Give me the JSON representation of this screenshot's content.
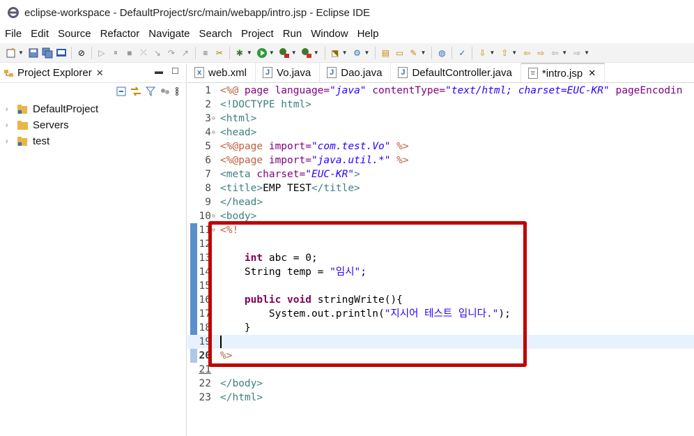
{
  "window": {
    "title": "eclipse-workspace - DefaultProject/src/main/webapp/intro.jsp - Eclipse IDE"
  },
  "menu": [
    "File",
    "Edit",
    "Source",
    "Refactor",
    "Navigate",
    "Search",
    "Project",
    "Run",
    "Window",
    "Help"
  ],
  "explorer": {
    "tab_label": "Project Explorer",
    "items": [
      {
        "label": "DefaultProject",
        "icon": "project-icon"
      },
      {
        "label": "Servers",
        "icon": "folder-icon"
      },
      {
        "label": "test",
        "icon": "project-icon"
      }
    ]
  },
  "editor": {
    "tabs": [
      {
        "label": "web.xml",
        "icon": "xml-file-icon",
        "active": false
      },
      {
        "label": "Vo.java",
        "icon": "java-file-icon",
        "active": false
      },
      {
        "label": "Dao.java",
        "icon": "java-file-icon",
        "active": false
      },
      {
        "label": "DefaultController.java",
        "icon": "java-file-icon",
        "active": false
      },
      {
        "label": "*intro.jsp",
        "icon": "jsp-file-icon",
        "active": true
      }
    ],
    "line_numbers": [
      "1",
      "2",
      "3",
      "4",
      "5",
      "6",
      "7",
      "8",
      "9",
      "10",
      "11",
      "12",
      "13",
      "14",
      "15",
      "16",
      "17",
      "18",
      "19",
      "20",
      "21",
      "22",
      "23"
    ],
    "code": {
      "l1_a": "<%@ ",
      "l1_b": "page ",
      "l1_c": "language=",
      "l1_d": "\"java\"",
      "l1_e": " contentType=",
      "l1_f": "\"text/html; charset=EUC-KR\"",
      "l1_g": " pageEncodin",
      "l2": "<!DOCTYPE html>",
      "l3": "<html>",
      "l4": "<head>",
      "l5_a": "<%@page ",
      "l5_b": "import=",
      "l5_c": "\"com.test.Vo\"",
      "l5_d": " %>",
      "l6_a": "<%@page ",
      "l6_b": "import=",
      "l6_c": "\"java.util.*\"",
      "l6_d": " %>",
      "l7_a": "<meta ",
      "l7_b": "charset=",
      "l7_c": "\"EUC-KR\"",
      "l7_d": ">",
      "l8_a": "<title>",
      "l8_b": "EMP TEST",
      "l8_c": "</title>",
      "l9": "</head>",
      "l10": "<body>",
      "l11": "<%!",
      "l13_a": "    int",
      "l13_b": " abc = 0;",
      "l14_a": "    String temp = ",
      "l14_b": "\"임시\"",
      "l14_c": ";",
      "l16_a": "    public",
      "l16_b": " ",
      "l16_c": "void",
      "l16_d": " stringWrite(){",
      "l17_a": "        System.out.println(",
      "l17_b": "\"지시어 테스트 입니다.\"",
      "l17_c": ");",
      "l18": "    }",
      "l20": "%>",
      "l22": "</body>",
      "l23": "</html>"
    }
  },
  "colors": {
    "highlight_box": "#c00000",
    "keyword": "#7f0055",
    "string": "#2a00ff",
    "tag": "#3f7f7f"
  }
}
